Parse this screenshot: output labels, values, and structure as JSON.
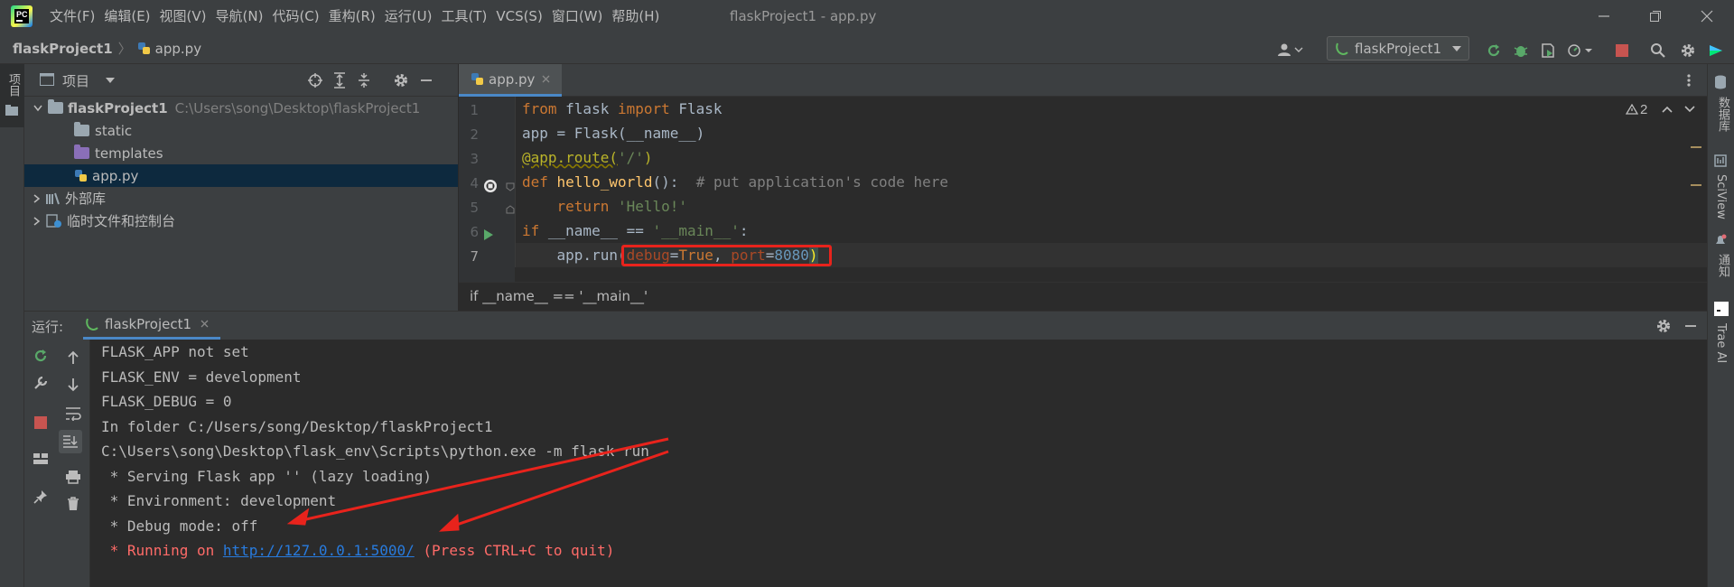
{
  "menu": [
    "文件(F)",
    "编辑(E)",
    "视图(V)",
    "导航(N)",
    "代码(C)",
    "重构(R)",
    "运行(U)",
    "工具(T)",
    "VCS(S)",
    "窗口(W)",
    "帮助(H)"
  ],
  "window_title": "flaskProject1 - app.py",
  "breadcrumb": {
    "project": "flaskProject1",
    "file": "app.py"
  },
  "run_config": "flaskProject1",
  "left_strip": {
    "project_tab": "项目"
  },
  "right_strip": {
    "database": "数据库",
    "sciview": "SciView",
    "notifications": "通知",
    "trae": "Trae AI"
  },
  "project_panel": {
    "title": "项目",
    "root": {
      "name": "flaskProject1",
      "path": "C:\\Users\\song\\Desktop\\flaskProject1"
    },
    "children": [
      "static",
      "templates",
      "app.py"
    ],
    "external_libraries": "外部库",
    "scratches": "临时文件和控制台"
  },
  "editor": {
    "tab": "app.py",
    "warnings": "2",
    "line_numbers": [
      "1",
      "2",
      "3",
      "4",
      "5",
      "6",
      "7"
    ],
    "code": {
      "l1": {
        "k1": "from",
        "t1": " flask ",
        "k2": "import",
        "t2": " Flask"
      },
      "l2": "app = Flask(__name__)",
      "l3": {
        "deco": "@app.route(",
        "str": "'/'",
        "end": ")"
      },
      "l4": {
        "kw": "def",
        "sp": " ",
        "fn": "hello_world",
        "sig": "():  ",
        "cmt": "# put application's code here"
      },
      "l5": {
        "indent": "    ",
        "kw": "return",
        "sp": " ",
        "str": "'Hello!'"
      },
      "l6": {
        "kw": "if",
        "mid": " __name__ == ",
        "str": "'__main__'",
        "end": ":"
      },
      "l7": {
        "pre": "    app.run(",
        "p1": "debug",
        "eq1": "=",
        "v1": "True",
        "sep": ", ",
        "p2": "port",
        "eq2": "=",
        "v2": "8080",
        "end": ")"
      }
    },
    "crumb": "if __name__ == '__main__'"
  },
  "run_panel": {
    "label": "运行:",
    "tab": "flaskProject1",
    "console": [
      "FLASK_APP not set",
      "FLASK_ENV = development",
      "FLASK_DEBUG = 0",
      "In folder C:/Users/song/Desktop/flaskProject1",
      "C:\\Users\\song\\Desktop\\flask_env\\Scripts\\python.exe -m flask run",
      " * Serving Flask app '' (lazy loading)",
      " * Environment: development",
      " * Debug mode: off"
    ],
    "running": {
      "prefix": " * Running on ",
      "url": "http://127.0.0.1:5000/",
      "suffix": " (Press CTRL+C to quit)"
    }
  },
  "colors": {
    "annotation_red": "#e8231c",
    "accent": "#4a88c7",
    "error_text": "#ff6b68"
  }
}
